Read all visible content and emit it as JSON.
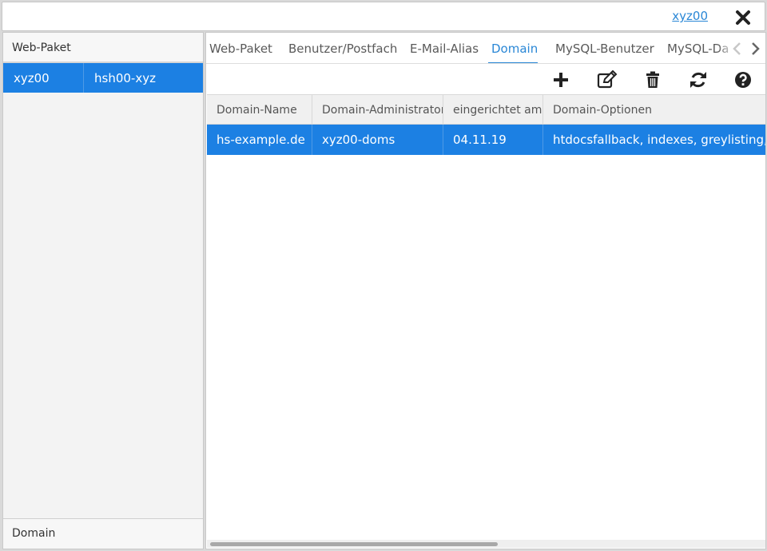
{
  "header": {
    "user_link": "xyz00",
    "close_icon": "close-icon"
  },
  "left": {
    "title": "Web-Paket",
    "rows": [
      {
        "name": "xyz00",
        "value": "hsh00-xyz"
      }
    ],
    "footer": "Domain"
  },
  "tabs": [
    {
      "label": "Web-Paket"
    },
    {
      "label": "Benutzer/Postfach"
    },
    {
      "label": "E-Mail-Alias"
    },
    {
      "label": "Domain",
      "active": true
    },
    {
      "label": "MySQL-Benutzer"
    },
    {
      "label": "MySQL-Da"
    }
  ],
  "toolbar": {
    "icons": [
      "plus-icon",
      "edit-icon",
      "trash-icon",
      "refresh-icon",
      "help-icon"
    ]
  },
  "table": {
    "columns": [
      "Domain-Name",
      "Domain-Administrator",
      "eingerichtet am",
      "Domain-Optionen"
    ],
    "rows": [
      [
        "hs-example.de",
        "xyz00-doms",
        "04.11.19",
        "htdocsfallback, indexes, greylisting, in"
      ]
    ]
  },
  "colors": {
    "accent": "#2a87d6",
    "selection": "#1c80e3"
  }
}
